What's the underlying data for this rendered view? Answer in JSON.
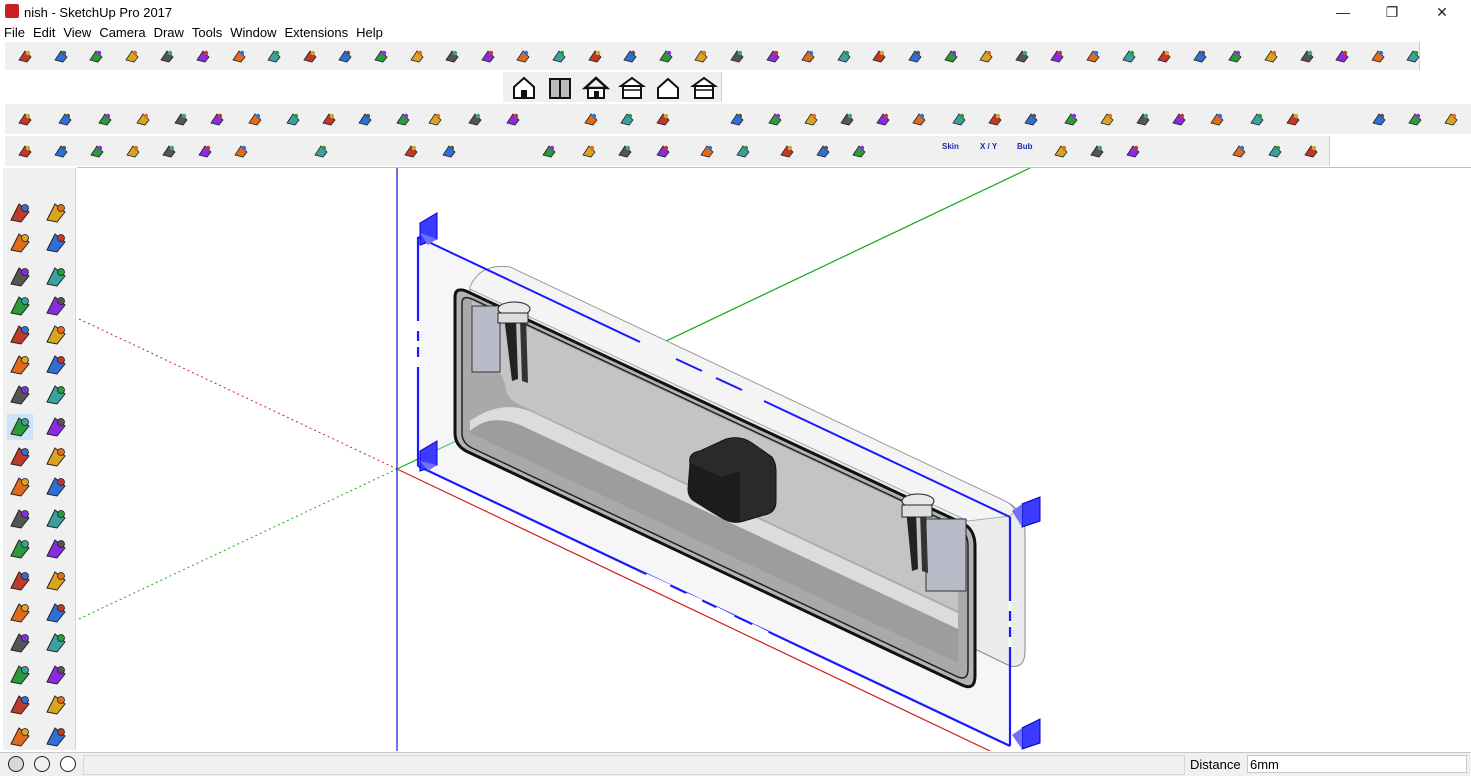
{
  "window": {
    "title": "nish - SketchUp Pro 2017",
    "minimize_glyph": "—",
    "restore_glyph": "❐",
    "close_glyph": "✕"
  },
  "menu": [
    "File",
    "Edit",
    "View",
    "Camera",
    "Draw",
    "Tools",
    "Window",
    "Extensions",
    "Help"
  ],
  "toolbars": {
    "views_icons": [
      "iso-view-icon",
      "top-view-icon",
      "front-view-icon",
      "right-view-icon",
      "back-view-icon",
      "left-view-icon"
    ],
    "sandbox_text_buttons": [
      "Skin",
      "X / Y",
      "Bub"
    ]
  },
  "left_tools": [
    "select-tool-icon",
    "component-tool-icon",
    "paint-bucket-icon",
    "eraser-icon",
    "line-tool-icon",
    "freehand-icon",
    "rectangle-icon",
    "rotated-rectangle-icon",
    "circle-icon",
    "polygon-icon",
    "arc-icon",
    "pie-icon",
    "two-point-arc-icon",
    "three-point-arc-icon",
    "move-tool-icon",
    "push-pull-icon",
    "rotate-tool-icon",
    "follow-me-icon",
    "scale-tool-icon",
    "offset-tool-icon",
    "tape-measure-icon",
    "dimension-icon",
    "protractor-icon",
    "text-tool-icon",
    "axes-tool-icon",
    "3d-text-icon",
    "orbit-icon",
    "pan-icon",
    "zoom-icon",
    "zoom-window-icon",
    "zoom-extents-icon",
    "previous-view-icon",
    "position-camera-icon",
    "look-around-icon",
    "walk-icon",
    "section-plane-icon"
  ],
  "status": {
    "vcb_label": "Distance",
    "vcb_value": "6mm"
  },
  "colors": {
    "axis_red": "#d42020",
    "axis_green": "#1aa81a",
    "axis_blue": "#1010e0",
    "section_plane": "#1a1aff",
    "model_gray": "#a8a8a8"
  }
}
